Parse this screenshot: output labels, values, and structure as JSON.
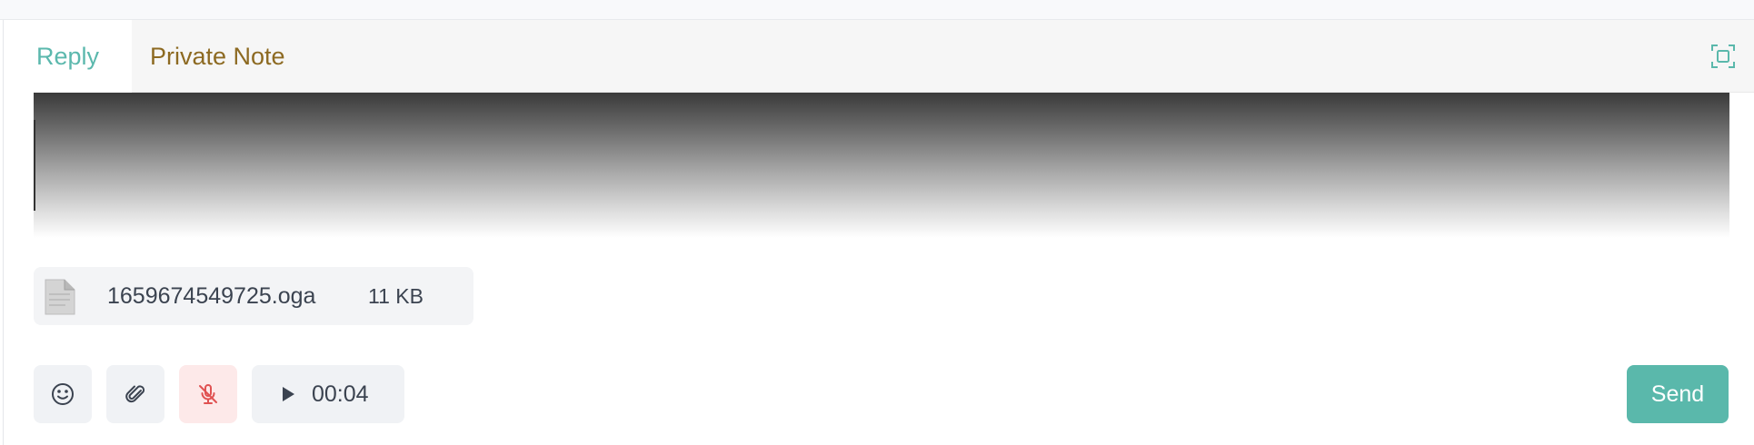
{
  "tabs": {
    "reply_label": "Reply",
    "note_label": "Private Note",
    "active": "Reply",
    "expand_icon": "expand-icon"
  },
  "attachment": {
    "file_name": "1659674549725.oga",
    "file_size": "11 KB",
    "thumb_icon": "file-document-icon"
  },
  "toolbar": {
    "emoji_icon": "emoji-icon",
    "attach_icon": "paperclip-icon",
    "mic_icon": "microphone-off-icon",
    "play_icon": "play-icon",
    "timer": "00:04",
    "send_label": "Send"
  },
  "colors": {
    "accent": "#5ab8ab",
    "reply_tab": "#5bb8ad",
    "note_tab": "#8d6a22",
    "mic_bg": "#fde9e9",
    "mic_icon": "#e05252"
  }
}
